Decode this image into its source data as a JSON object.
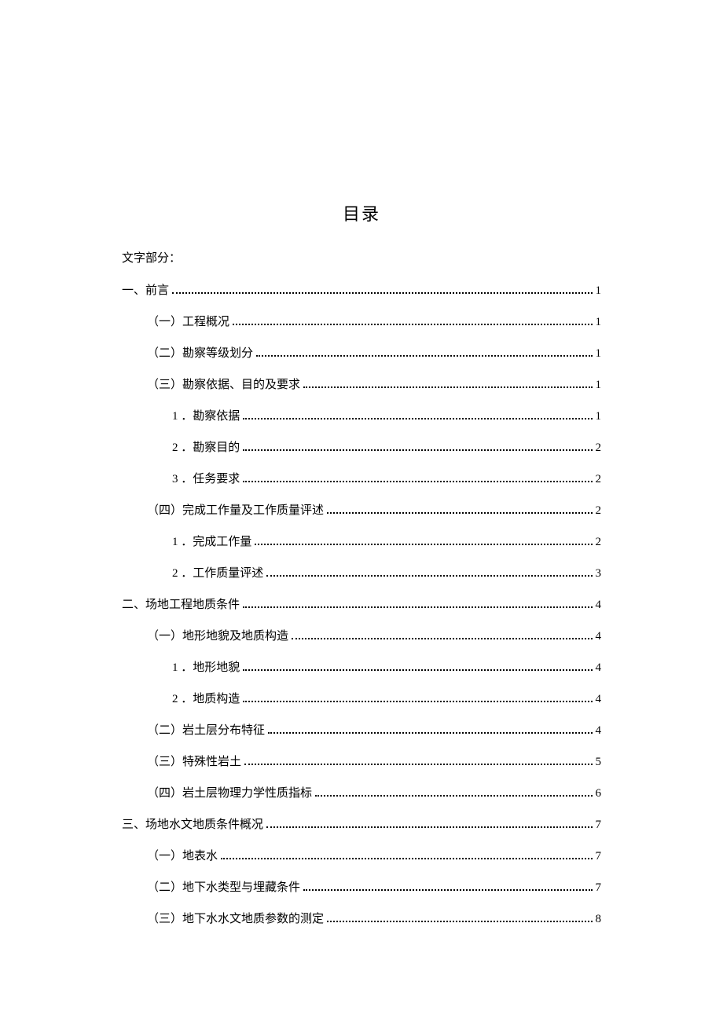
{
  "title": "目录",
  "section_label": "文字部分：",
  "toc": [
    {
      "level": 0,
      "text": "一、前言",
      "page": "1"
    },
    {
      "level": 1,
      "text": "（一）工程概况",
      "page": "1"
    },
    {
      "level": 1,
      "text": "（二）勘察等级划分",
      "page": "1"
    },
    {
      "level": 1,
      "text": "（三）勘察依据、目的及要求",
      "page": "1"
    },
    {
      "level": 2,
      "text": "1  ．勘察依据",
      "page": "1"
    },
    {
      "level": 2,
      "text": "2  ．勘察目的",
      "page": "2"
    },
    {
      "level": 2,
      "text": "3  ．任务要求",
      "page": "2"
    },
    {
      "level": 1,
      "text": "（四）完成工作量及工作质量评述",
      "page": "2"
    },
    {
      "level": 2,
      "text": "1  ．完成工作量",
      "page": "2"
    },
    {
      "level": 2,
      "text": "2  ．工作质量评述",
      "page": "3"
    },
    {
      "level": 0,
      "text": "二、场地工程地质条件",
      "page": "4"
    },
    {
      "level": 1,
      "text": "（一）地形地貌及地质构造",
      "page": "4"
    },
    {
      "level": 2,
      "text": "1  ．地形地貌",
      "page": "4"
    },
    {
      "level": 2,
      "text": "2  ．地质构造",
      "page": "4"
    },
    {
      "level": 1,
      "text": "（二）岩土层分布特征",
      "page": "4"
    },
    {
      "level": 1,
      "text": "（三）特殊性岩土",
      "page": "5"
    },
    {
      "level": 1,
      "text": "（四）岩土层物理力学性质指标",
      "page": "6"
    },
    {
      "level": 0,
      "text": "三、场地水文地质条件概况",
      "page": "7"
    },
    {
      "level": 1,
      "text": "（一）地表水",
      "page": "7"
    },
    {
      "level": 1,
      "text": "（二）地下水类型与埋藏条件",
      "page": "7"
    },
    {
      "level": 1,
      "text": "（三）地下水水文地质参数的测定",
      "page": "8"
    }
  ]
}
